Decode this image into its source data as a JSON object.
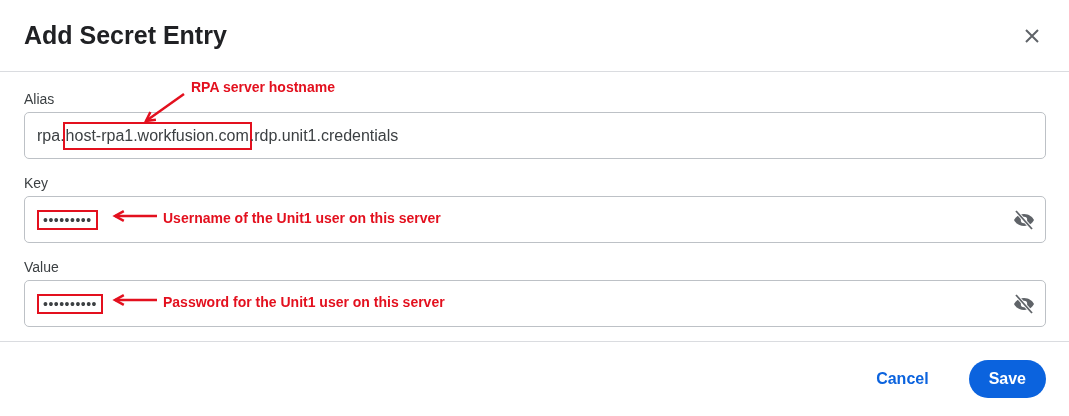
{
  "dialog": {
    "title": "Add Secret Entry"
  },
  "fields": [
    {
      "kind": "text",
      "label": "Alias",
      "value_segments": [
        {
          "text": "rpa.",
          "highlighted": false
        },
        {
          "text": "host-rpa1.workfusion.com",
          "highlighted": true
        },
        {
          "text": ".rdp.unit1.credentials",
          "highlighted": false
        }
      ],
      "annotation": "RPA server hostname"
    },
    {
      "kind": "secret",
      "label": "Key",
      "value": "•••••••••",
      "highlighted": true,
      "masked": true,
      "annotation": "Username of the Unit1 user on this server"
    },
    {
      "kind": "secret",
      "label": "Value",
      "value": "••••••••••",
      "highlighted": true,
      "masked": true,
      "annotation": "Password for the Unit1 user on this server"
    }
  ],
  "buttons": [
    {
      "kind": "text",
      "label": "Cancel"
    },
    {
      "kind": "primary",
      "label": "Save"
    }
  ]
}
